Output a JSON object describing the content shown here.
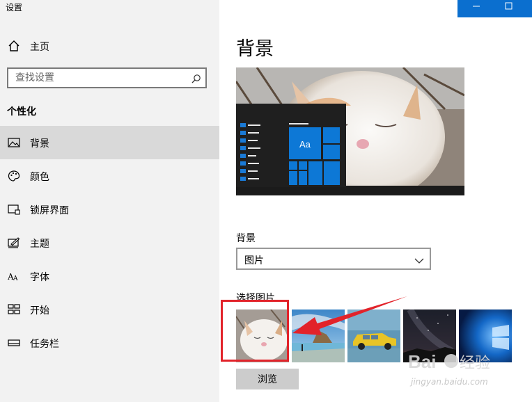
{
  "window": {
    "title": "设置"
  },
  "sidebar": {
    "home_label": "主页",
    "search_placeholder": "查找设置",
    "section_heading": "个性化",
    "items": [
      {
        "label": "背景",
        "icon": "picture-icon",
        "selected": true
      },
      {
        "label": "颜色",
        "icon": "palette-icon",
        "selected": false
      },
      {
        "label": "锁屏界面",
        "icon": "lock-screen-icon",
        "selected": false
      },
      {
        "label": "主题",
        "icon": "theme-icon",
        "selected": false
      },
      {
        "label": "字体",
        "icon": "font-icon",
        "selected": false
      },
      {
        "label": "开始",
        "icon": "start-icon",
        "selected": false
      },
      {
        "label": "任务栏",
        "icon": "taskbar-icon",
        "selected": false
      }
    ]
  },
  "main": {
    "title": "背景",
    "preview": {
      "tile_text": "Aa"
    },
    "background_label": "背景",
    "background_value": "图片",
    "choose_picture_label": "选择图片",
    "thumbnails": [
      {
        "name": "cat",
        "selected": true
      },
      {
        "name": "beach-rocks",
        "selected": false
      },
      {
        "name": "yellow-car",
        "selected": false
      },
      {
        "name": "night-sky",
        "selected": false
      },
      {
        "name": "windows-10",
        "selected": false
      }
    ],
    "browse_label": "浏览"
  },
  "watermark": {
    "text": "jingyan.baidu.com",
    "logo_text": "Baidu 经验"
  },
  "colors": {
    "accent": "#0078d7",
    "highlight": "#e2232a",
    "sidebar_bg": "#f2f2f2",
    "caption_bar": "#0b6fcf"
  }
}
